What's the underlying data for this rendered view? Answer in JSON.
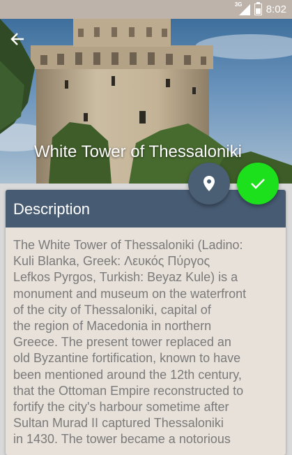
{
  "status_bar": {
    "network": "3G",
    "time": "8:02"
  },
  "header": {
    "title": "White Tower of Thessaloniki",
    "back_icon": "arrow-back-icon"
  },
  "actions": {
    "map_icon": "location-pin-icon",
    "check_icon": "check-icon",
    "check_color": "#1be01b",
    "map_color": "#4a5e74"
  },
  "description": {
    "heading": "Description",
    "lines": [
      "The White Tower of Thessaloniki (Ladino:",
      "Kuli Blanka, Greek: Λευκός Πύργος",
      "Lefkos Pyrgos, Turkish: Beyaz Kule) is a",
      "monument and museum on the waterfront",
      "of the city of Thessaloniki, capital of",
      "the region of Macedonia in northern",
      "Greece. The present tower replaced an",
      "old Byzantine fortification, known to have",
      "been mentioned around the 12th century,",
      "that the Ottoman Empire reconstructed to",
      "fortify the city's harbour sometime after",
      "Sultan Murad II captured Thessaloniki",
      "in 1430. The tower became a notorious"
    ]
  }
}
